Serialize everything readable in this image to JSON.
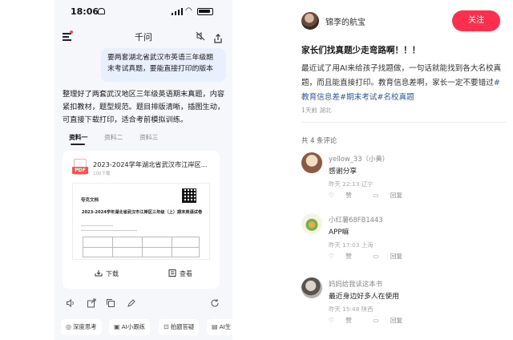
{
  "phone": {
    "status": {
      "time": "18:06"
    },
    "header": {
      "title": "千问"
    },
    "user_message": "要两套湖北省武汉市英语三年级期末考试真题，要能直接打印的版本",
    "answer": "整理好了两套武汉地区三年级英语期末真题，内容紧扣教材，题型规范。题目排版清晰，插图生动，可直接下载打印，适合考前模拟训练。",
    "tabs": [
      "资料一",
      "资料二",
      "资料三"
    ],
    "file": {
      "badge": "PDF",
      "title": "2023-2024学年湖北省武汉市江岸区...",
      "size": "100下载",
      "preview_brand": "夸克文档",
      "preview_title": "2023-2024学年湖北省武汉市江岸区三年级（上）期末英语试卷",
      "download_label": "下载",
      "view_label": "查看"
    },
    "chips": [
      {
        "icon": "◎",
        "label": "深度思考"
      },
      {
        "icon": "▣",
        "label": "AI小跟练"
      },
      {
        "icon": "⊡",
        "label": "拍题答疑"
      },
      {
        "icon": "▤",
        "label": "AI生"
      }
    ]
  },
  "post": {
    "author": "锦李的航宝",
    "follow_label": "关注",
    "title": "家长们找真题少走弯路啊！！！",
    "body": "最近试了用AI来给孩子找题做，一句话就能找到各大名校真题，而且能直接打印。教育信息差啊，家长一定不要错过",
    "tags": "#教育信息差#期末考试#名校真题",
    "meta": "1天前 湖北",
    "comment_count": "共 4 条评论",
    "comments": [
      {
        "name": "yellow_33（小黄）",
        "text": "感谢分享",
        "meta": "昨天 22:13 辽宁",
        "like": "赞",
        "reply": "回复",
        "avatar": "#e7c7a8"
      },
      {
        "name": "小红薯68FB1443",
        "text": "APP嘛",
        "meta": "昨天 17:03 上海",
        "like": "赞",
        "reply": "回复",
        "avatar": "#f4f1d8"
      },
      {
        "name": "妈妈给我读这本书",
        "text": "最近身边好多人在使用",
        "meta": "昨天 15:48 陕西",
        "like": "赞",
        "reply": "回复",
        "avatar": "#cfc9c4"
      }
    ]
  },
  "colors": {
    "accent": "#ff2e4d",
    "bubble": "#e8effd",
    "tag_link": "#2f5a9e",
    "pdf_red": "#f0574e"
  }
}
